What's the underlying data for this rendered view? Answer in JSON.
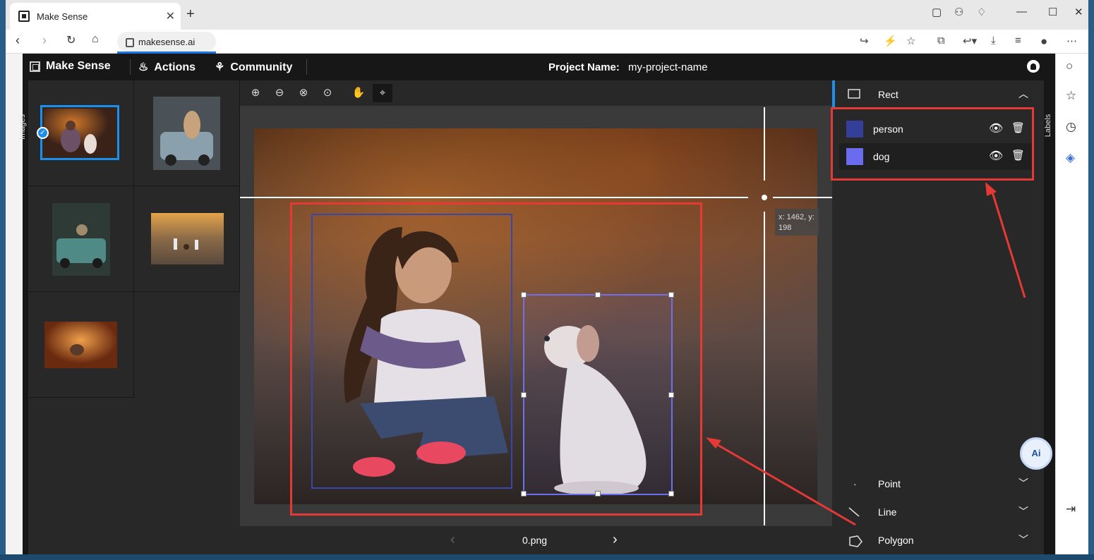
{
  "browser": {
    "tab_title": "Make Sense",
    "url": "makesense.ai"
  },
  "app": {
    "brand": "Make Sense",
    "nav_actions": "Actions",
    "nav_community": "Community",
    "project_label": "Project Name:",
    "project_name": "my-project-name",
    "images_tab": "Images",
    "labels_tab": "Labels"
  },
  "editor": {
    "coords_line1": "x: 1462, y:",
    "coords_line2": "198",
    "filename": "0.png"
  },
  "labels": {
    "sections": [
      {
        "name": "Rect",
        "icon": "rect-icon",
        "expanded": true
      },
      {
        "name": "Point",
        "icon": "point-icon",
        "expanded": false
      },
      {
        "name": "Line",
        "icon": "line-icon",
        "expanded": false
      },
      {
        "name": "Polygon",
        "icon": "polygon-icon",
        "expanded": false
      }
    ],
    "items": [
      {
        "name": "person",
        "color": "#333f99"
      },
      {
        "name": "dog",
        "color": "#6b6bf0"
      }
    ]
  },
  "ai_button": "Ai",
  "colors": {
    "accent": "#1e8ee8",
    "annotation_red": "#e53935",
    "person_box": "#3a46a8",
    "dog_box": "#6f6ff0"
  }
}
